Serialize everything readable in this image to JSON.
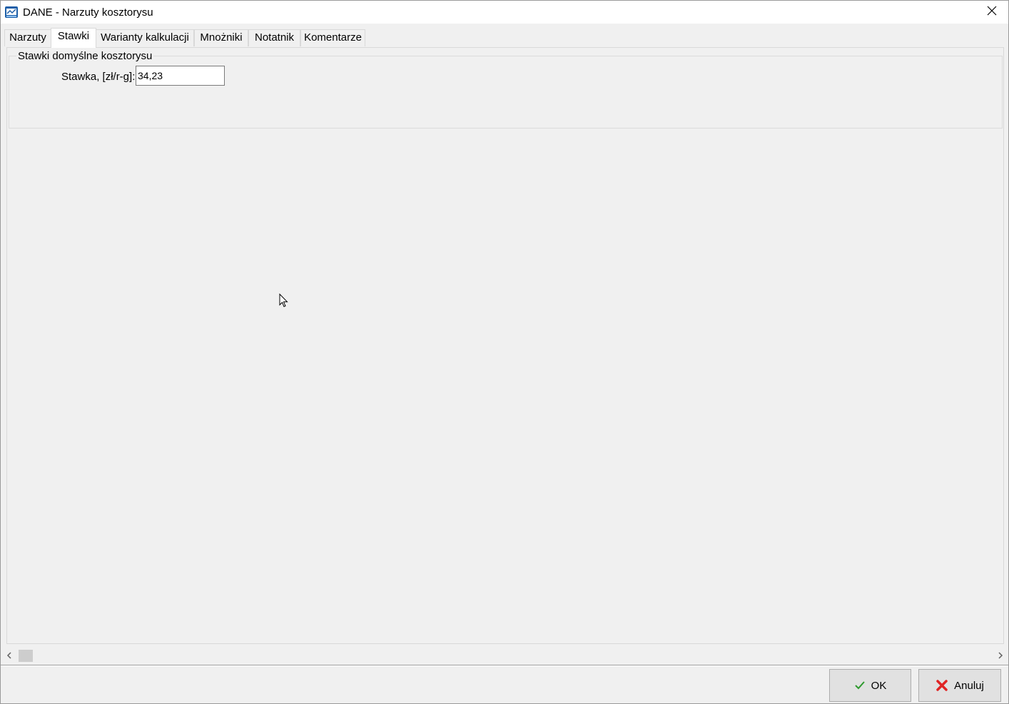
{
  "window": {
    "title": "DANE - Narzuty kosztorysu"
  },
  "tabs": [
    {
      "label": "Narzuty",
      "active": false
    },
    {
      "label": "Stawki",
      "active": true
    },
    {
      "label": "Warianty kalkulacji",
      "active": false
    },
    {
      "label": "Mnożniki",
      "active": false
    },
    {
      "label": "Notatnik",
      "active": false
    },
    {
      "label": "Komentarze",
      "active": false
    }
  ],
  "rates_group": {
    "legend": "Stawki domyślne kosztorysu",
    "rate_label": "Stawka, [zł/r-g]:",
    "rate_value": "34,23"
  },
  "footer": {
    "ok_label": "OK",
    "cancel_label": "Anuluj"
  },
  "colors": {
    "ok_check": "#2e9a2e",
    "cancel_x": "#e02424"
  },
  "icons": {
    "app": "app-icon",
    "close": "close-icon",
    "ok": "check-icon",
    "cancel": "x-icon"
  }
}
